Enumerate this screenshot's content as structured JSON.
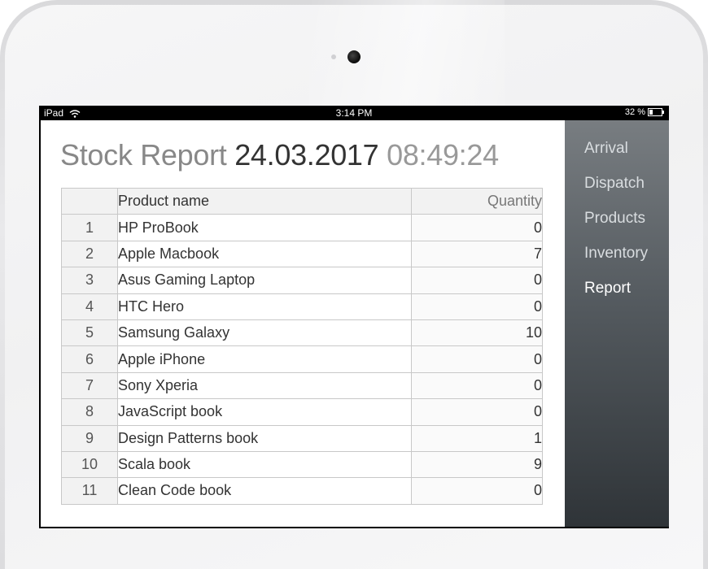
{
  "statusbar": {
    "device": "iPad",
    "time": "3:14 PM",
    "battery": "32 %"
  },
  "header": {
    "title": "Stock Report",
    "date": "24.03.2017",
    "time": "08:49:24"
  },
  "table": {
    "columns": [
      "",
      "Product name",
      "Quantity"
    ],
    "rows": [
      {
        "num": "1",
        "name": "HP ProBook",
        "qty": "0"
      },
      {
        "num": "2",
        "name": "Apple Macbook",
        "qty": "7"
      },
      {
        "num": "3",
        "name": "Asus Gaming Laptop",
        "qty": "0"
      },
      {
        "num": "4",
        "name": "HTC Hero",
        "qty": "0"
      },
      {
        "num": "5",
        "name": "Samsung Galaxy",
        "qty": "10"
      },
      {
        "num": "6",
        "name": "Apple iPhone",
        "qty": "0"
      },
      {
        "num": "7",
        "name": "Sony Xperia",
        "qty": "0"
      },
      {
        "num": "8",
        "name": "JavaScript book",
        "qty": "0"
      },
      {
        "num": "9",
        "name": "Design Patterns book",
        "qty": "1"
      },
      {
        "num": "10",
        "name": "Scala book",
        "qty": "9"
      },
      {
        "num": "11",
        "name": "Clean Code book",
        "qty": "0"
      }
    ]
  },
  "sidebar": {
    "items": [
      {
        "label": "Arrival",
        "active": false
      },
      {
        "label": "Dispatch",
        "active": false
      },
      {
        "label": "Products",
        "active": false
      },
      {
        "label": "Inventory",
        "active": false
      },
      {
        "label": "Report",
        "active": true
      }
    ]
  },
  "icons": [
    "wifi-icon",
    "battery-icon",
    "camera-icon"
  ]
}
